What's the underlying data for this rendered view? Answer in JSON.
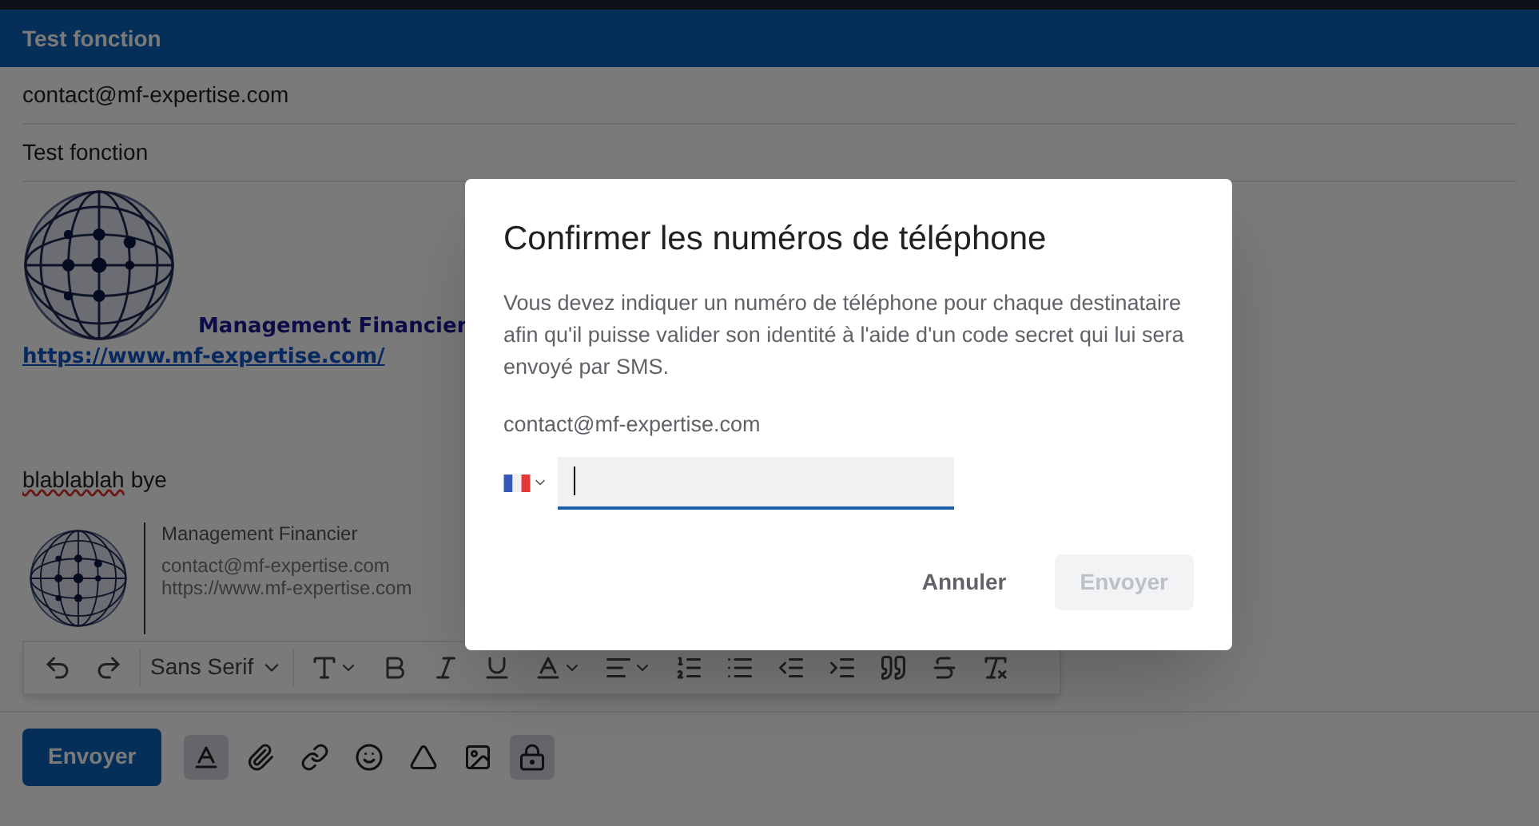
{
  "compose": {
    "title": "Test fonction",
    "recipient": "contact@mf-expertise.com",
    "subject": "Test fonction",
    "signature": {
      "company": "Management Financier",
      "url": "https://www.mf-expertise.com/"
    },
    "message": [
      {
        "text": "blablablah",
        "misspelled": true
      },
      {
        "text": "bye",
        "misspelled": false
      }
    ],
    "signature_card": {
      "company": "Management Financier",
      "email": "contact@mf-expertise.com",
      "website": "https://www.mf-expertise.com"
    },
    "formatting_toolbar": {
      "font": "Sans Serif",
      "tools": [
        {
          "kind": "undo"
        },
        {
          "kind": "redo"
        },
        {
          "kind": "font"
        },
        {
          "kind": "size"
        },
        {
          "kind": "bold"
        },
        {
          "kind": "italic"
        },
        {
          "kind": "underline"
        },
        {
          "kind": "color"
        },
        {
          "kind": "align"
        },
        {
          "kind": "numbered"
        },
        {
          "kind": "bulleted"
        },
        {
          "kind": "outdent"
        },
        {
          "kind": "indent"
        },
        {
          "kind": "quote"
        },
        {
          "kind": "strike"
        },
        {
          "kind": "clear"
        }
      ]
    },
    "send_button": "Envoyer",
    "bottom_tools": [
      {
        "kind": "formatting",
        "selected": true
      },
      {
        "kind": "attach",
        "selected": false
      },
      {
        "kind": "link",
        "selected": false
      },
      {
        "kind": "emoji",
        "selected": false
      },
      {
        "kind": "drive",
        "selected": false
      },
      {
        "kind": "photo",
        "selected": false
      },
      {
        "kind": "confidential",
        "selected": true
      }
    ]
  },
  "dialog": {
    "title": "Confirmer les numéros de téléphone",
    "description": "Vous devez indiquer un numéro de téléphone pour chaque destinataire afin qu'il puisse valider son identité à l'aide d'un code secret qui lui sera envoyé par SMS.",
    "recipient": "contact@mf-expertise.com",
    "buttons": [
      {
        "label": "Annuler",
        "disabled": false
      },
      {
        "label": "Envoyer",
        "disabled": true
      }
    ]
  }
}
